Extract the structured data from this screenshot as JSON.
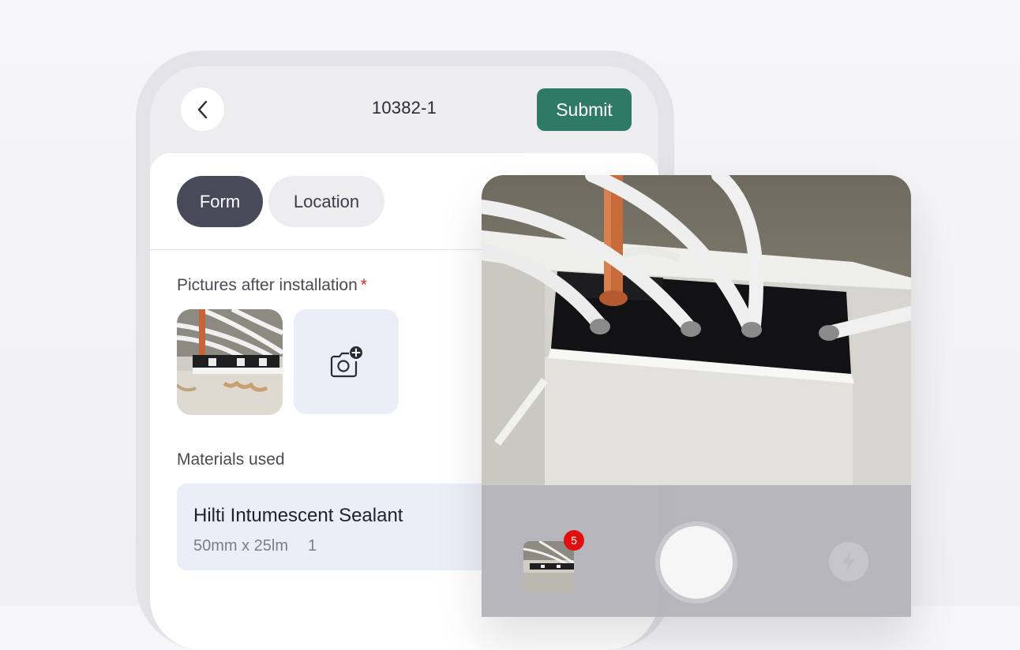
{
  "header": {
    "title": "10382-1",
    "submit_label": "Submit"
  },
  "tabs": [
    {
      "label": "Form",
      "active": true
    },
    {
      "label": "Location",
      "active": false
    }
  ],
  "pictures": {
    "label": "Pictures after installation",
    "required_marker": "*",
    "count": 1
  },
  "materials": {
    "label": "Materials used",
    "items": [
      {
        "name": "Hilti Intumescent Sealant",
        "size": "50mm x 25lm",
        "quantity": "1"
      }
    ]
  },
  "camera": {
    "photo_count_badge": "5"
  },
  "icons": {
    "back": "chevron-left-icon",
    "add_photo": "camera-plus-icon",
    "flash": "lightning-bolt-icon"
  },
  "colors": {
    "accent": "#2f7a67",
    "active_tab": "#494a59",
    "required": "#d42a2a",
    "badge": "#e01010"
  }
}
